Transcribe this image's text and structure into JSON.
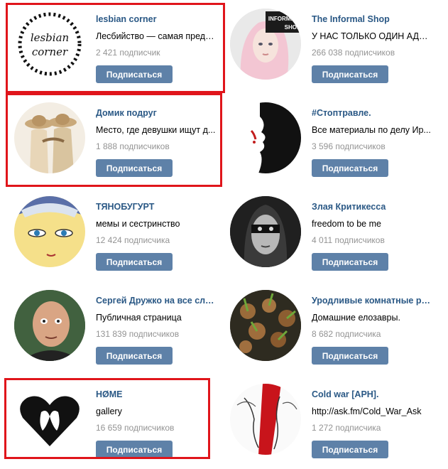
{
  "subscribe_label": "Подписаться",
  "highlight_color": "#e0151b",
  "button_color": "#5e81a8",
  "link_color": "#2a5885",
  "avatar_texts": {
    "lesbian_corner": [
      "lesbian",
      "corner"
    ],
    "informal_shop": [
      "INFORMAL",
      "SHOP"
    ]
  },
  "communities": [
    {
      "title": "lesbian corner",
      "description": "Лесбийство — самая преда...",
      "subscribers": "2 421 подписчик",
      "avatar": "wreath-text-avatar",
      "highlighted": true
    },
    {
      "title": "The Informal Shop",
      "description": "У НАС ТОЛЬКО ОДИН АДМ...",
      "subscribers": "266 038 подписчиков",
      "avatar": "pink-hair-girl-avatar",
      "highlighted": false
    },
    {
      "title": "Домик подруг",
      "description": "Место, где девушки ищут д...",
      "subscribers": "1 888 подписчиков",
      "avatar": "two-girls-hats-avatar",
      "highlighted": true
    },
    {
      "title": "#Стоптравле.",
      "description": "Все материалы по делу Ир...",
      "subscribers": "3 596 подписчиков",
      "avatar": "face-silhouette-avatar",
      "highlighted": false
    },
    {
      "title": "ТЯНОБУГУРТ",
      "description": "мемы и сестринство",
      "subscribers": "12 424 подписчика",
      "avatar": "anime-face-avatar",
      "highlighted": false
    },
    {
      "title": "Злая Критикесса",
      "description": "freedom to be me",
      "subscribers": "4 011 подписчиков",
      "avatar": "masked-woman-avatar",
      "highlighted": false
    },
    {
      "title": "Сергей Дружко на все слу...",
      "description": "Публичная страница",
      "subscribers": "131 839 подписчиков",
      "avatar": "bald-man-avatar",
      "highlighted": false
    },
    {
      "title": "Уродливые комнатные ра...",
      "description": "Домашние елозавры.",
      "subscribers": "8 682 подписчика",
      "avatar": "plants-avatar",
      "highlighted": false
    },
    {
      "title": "HØME",
      "description": "gallery",
      "subscribers": "16 659 подписчиков",
      "avatar": "heart-kiss-avatar",
      "highlighted": true
    },
    {
      "title": "Cold war [APH].",
      "description": "http://ask.fm/Cold_War_Ask",
      "subscribers": "1 272 подписчика",
      "avatar": "manga-couple-avatar",
      "highlighted": false
    }
  ]
}
